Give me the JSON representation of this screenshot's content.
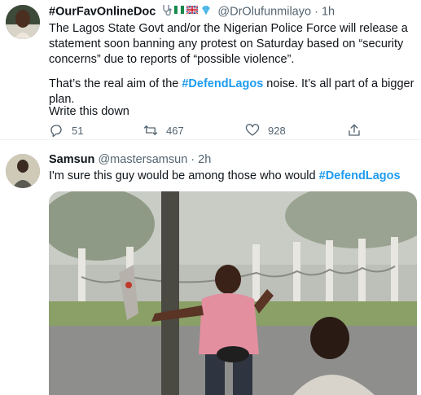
{
  "tweet1": {
    "display_name": "#OurFavOnlineDoc",
    "handle": "@DrOlufunmilayo",
    "separator": "·",
    "time": "1h",
    "para1": "The Lagos State Govt and/or the Nigerian Police Force will release a statement soon banning any protest on Saturday based on “security concerns” due to reports of “possible violence”.",
    "para2_before": "That’s the real aim of the ",
    "para2_hashtag": "#DefendLagos",
    "para2_after": " noise. It’s all part of a bigger plan.",
    "para3": "Write this down",
    "replies": "51",
    "retweets": "467",
    "likes": "928"
  },
  "tweet2": {
    "display_name": "Samsun",
    "handle": "@mastersamsun",
    "separator": "·",
    "time": "2h",
    "text_before": "I'm sure this guy would be among those who would ",
    "hashtag": "#DefendLagos"
  },
  "colors": {
    "accent": "#1d9bf0",
    "secondary_text": "#536471",
    "primary_text": "#0f1419"
  },
  "icons": [
    "stethoscope-icon",
    "nigeria-flag-icon",
    "uk-flag-icon",
    "diamond-icon",
    "reply-icon",
    "retweet-icon",
    "like-icon",
    "share-icon"
  ]
}
